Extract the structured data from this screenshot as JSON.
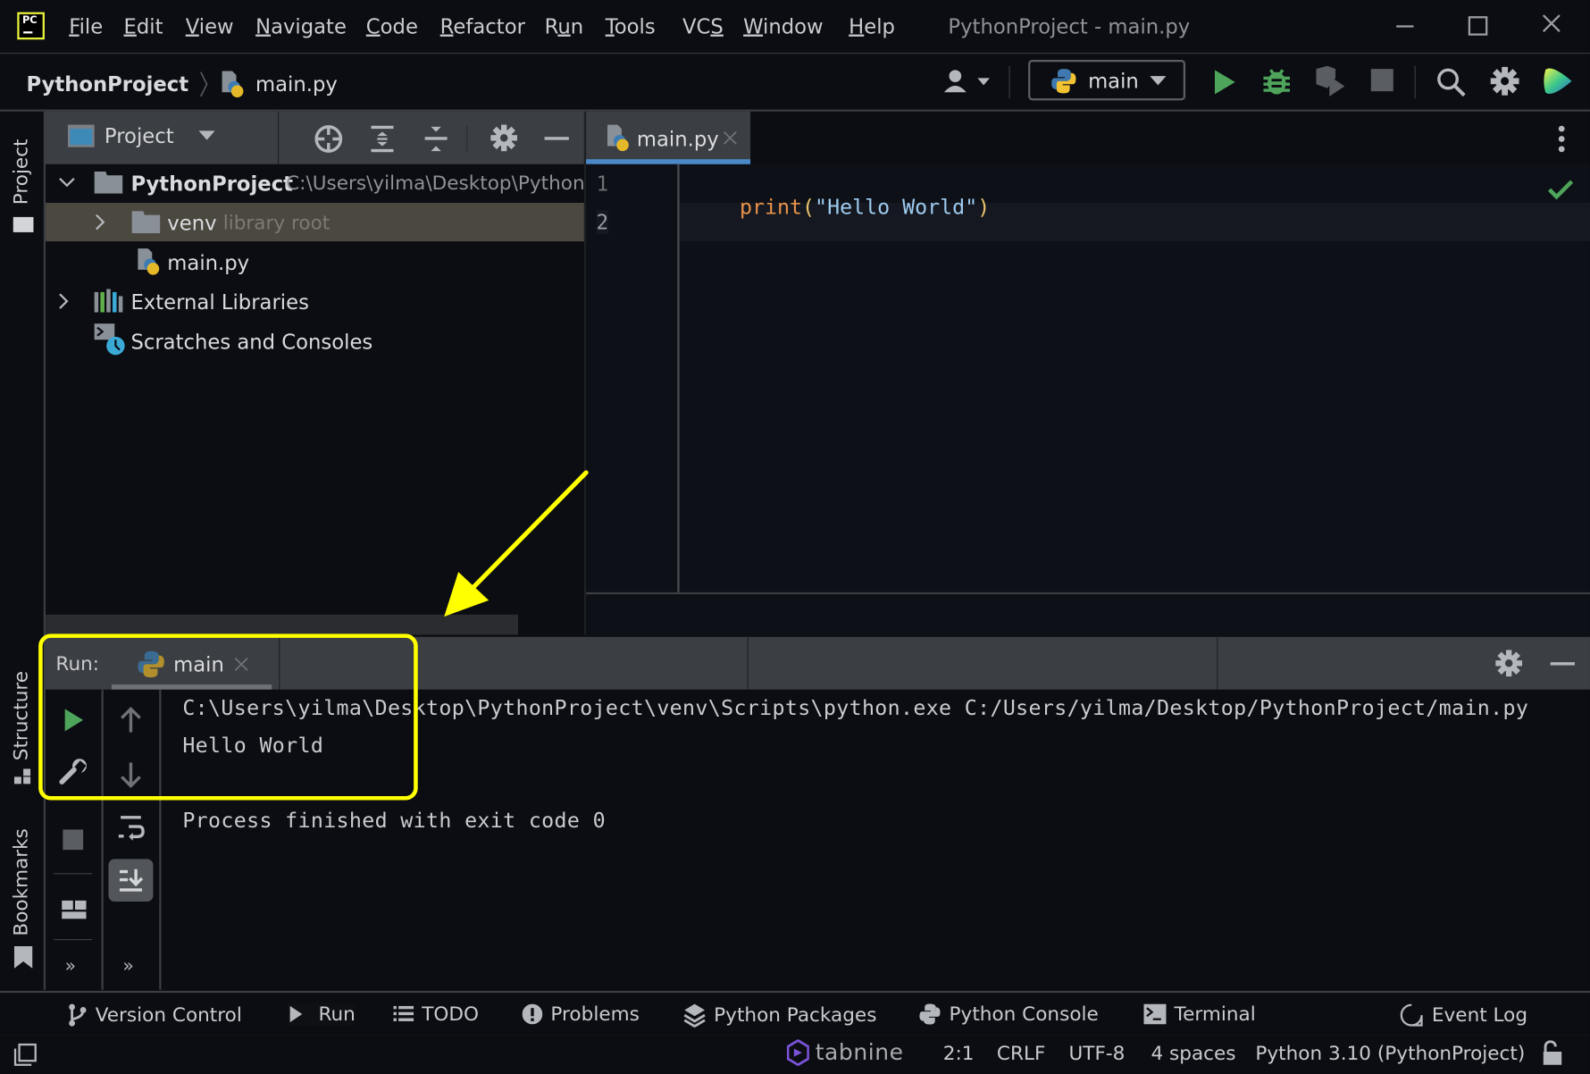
{
  "window": {
    "title": "PythonProject - main.py",
    "logo": "pycharm-logo",
    "controls": [
      "minimize",
      "maximize",
      "close"
    ]
  },
  "menu": [
    {
      "label": "File",
      "mnemonic": "F",
      "rest": "ile"
    },
    {
      "label": "Edit",
      "mnemonic": "E",
      "rest": "dit"
    },
    {
      "label": "View",
      "mnemonic": "V",
      "rest": "iew"
    },
    {
      "label": "Navigate",
      "mnemonic": "N",
      "rest": "avigate"
    },
    {
      "label": "Code",
      "mnemonic": "C",
      "rest": "ode"
    },
    {
      "label": "Refactor",
      "mnemonic": "R",
      "rest": "efactor"
    },
    {
      "label": "Run",
      "pre": "R",
      "mnemonic": "u",
      "rest": "n"
    },
    {
      "label": "Tools",
      "mnemonic": "T",
      "rest": "ools"
    },
    {
      "label": "VCS",
      "pre": "VC",
      "mnemonic": "S",
      "rest": ""
    },
    {
      "label": "Window",
      "mnemonic": "W",
      "rest": "indow"
    },
    {
      "label": "Help",
      "mnemonic": "H",
      "rest": "elp"
    }
  ],
  "breadcrumb": {
    "project": "PythonProject",
    "file": "main.py"
  },
  "toolbar": {
    "run_config": "main",
    "icons": [
      "user-icon",
      "run-icon",
      "debug-icon",
      "coverage-icon",
      "stop-icon",
      "search-icon",
      "settings-icon",
      "code-with-me-icon"
    ]
  },
  "left_stripe": {
    "project": "Project",
    "structure": "Structure",
    "bookmarks": "Bookmarks"
  },
  "project_panel": {
    "view_label": "Project",
    "tree": [
      {
        "label": "PythonProject",
        "hint": "C:\\Users\\yilma\\Desktop\\Python",
        "expanded": true
      },
      {
        "label": "venv",
        "hint": "library root",
        "expanded": false,
        "selected": true
      },
      {
        "label": "main.py"
      },
      {
        "label": "External Libraries",
        "expanded": false
      },
      {
        "label": "Scratches and Consoles"
      }
    ]
  },
  "editor": {
    "tab_label": "main.py",
    "lines": [
      {
        "number": "1",
        "fn": "print",
        "open": "(",
        "string": "\"Hello World\"",
        "close": ")"
      },
      {
        "number": "2"
      }
    ],
    "status": "no-problems"
  },
  "run_panel": {
    "label": "Run:",
    "tab_label": "main",
    "output": [
      "C:\\Users\\yilma\\Desktop\\PythonProject\\venv\\Scripts\\python.exe C:/Users/yilma/Desktop/PythonProject/main.py",
      "Hello World",
      "",
      "Process finished with exit code 0"
    ],
    "more_label": "»"
  },
  "bottom_tools": [
    {
      "label": "Version Control"
    },
    {
      "label": "Run"
    },
    {
      "label": "TODO"
    },
    {
      "label": "Problems"
    },
    {
      "label": "Python Packages"
    },
    {
      "label": "Python Console"
    },
    {
      "label": "Terminal"
    },
    {
      "label": "Event Log"
    }
  ],
  "statusbar": {
    "plugin": "tabnine",
    "position": "2:1",
    "line_sep": "CRLF",
    "encoding": "UTF-8",
    "indent": "4 spaces",
    "interpreter": "Python 3.10 (PythonProject)"
  },
  "annotation": {
    "color": "#ffff00"
  },
  "colors": {
    "accent_tab": "#4a88c7",
    "run_green": "#4ea45a",
    "keyword_orange": "#e8924a",
    "string_blue": "#9ecbf0"
  }
}
